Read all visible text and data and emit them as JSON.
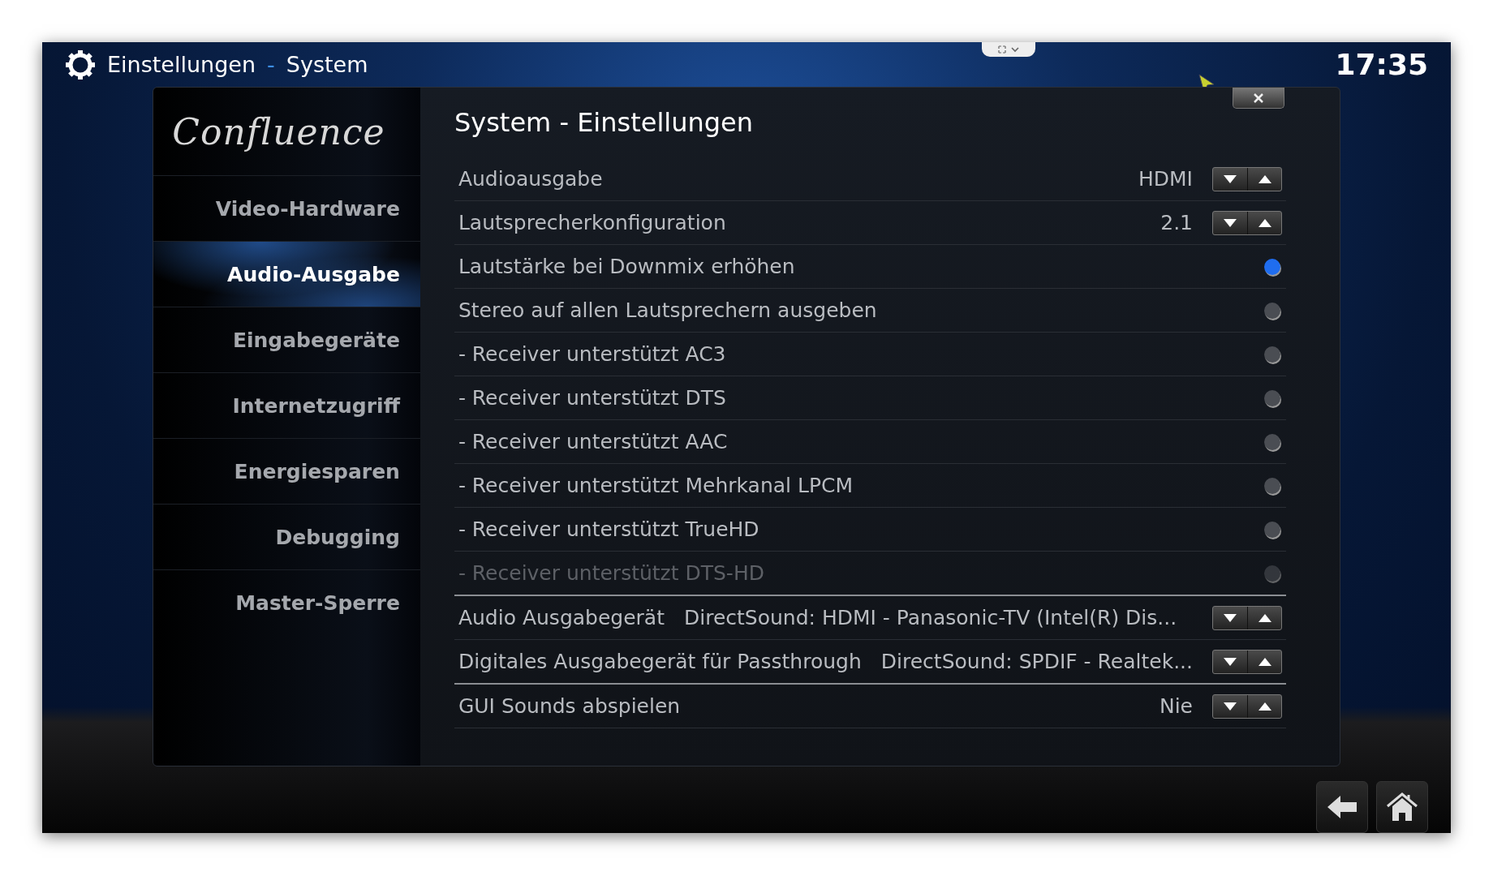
{
  "header": {
    "title": "Einstellungen",
    "separator": "-",
    "subtitle": "System",
    "clock": "17:35"
  },
  "sidebar": {
    "logo": "Confluence",
    "items": [
      {
        "label": "Video-Hardware",
        "selected": false
      },
      {
        "label": "Audio-Ausgabe",
        "selected": true
      },
      {
        "label": "Eingabegeräte",
        "selected": false
      },
      {
        "label": "Internetzugriff",
        "selected": false
      },
      {
        "label": "Energiesparen",
        "selected": false
      },
      {
        "label": "Debugging",
        "selected": false
      },
      {
        "label": "Master-Sperre",
        "selected": false
      }
    ]
  },
  "dialog": {
    "title": "System - Einstellungen",
    "settings": [
      {
        "kind": "spin",
        "label": "Audioausgabe",
        "value": "HDMI",
        "disabled": false
      },
      {
        "kind": "spin",
        "label": "Lautsprecherkonfiguration",
        "value": "2.1",
        "disabled": false
      },
      {
        "kind": "toggle",
        "label": "Lautstärke bei Downmix erhöhen",
        "on": true,
        "disabled": false
      },
      {
        "kind": "toggle",
        "label": "Stereo auf allen Lautsprechern ausgeben",
        "on": false,
        "disabled": false
      },
      {
        "kind": "toggle",
        "label": "- Receiver unterstützt AC3",
        "on": false,
        "disabled": false
      },
      {
        "kind": "toggle",
        "label": "- Receiver unterstützt DTS",
        "on": false,
        "disabled": false
      },
      {
        "kind": "toggle",
        "label": "- Receiver unterstützt AAC",
        "on": false,
        "disabled": false
      },
      {
        "kind": "toggle",
        "label": "- Receiver unterstützt Mehrkanal LPCM",
        "on": false,
        "disabled": false
      },
      {
        "kind": "toggle",
        "label": "- Receiver unterstützt TrueHD",
        "on": false,
        "disabled": false
      },
      {
        "kind": "toggle",
        "label": "- Receiver unterstützt DTS-HD",
        "on": false,
        "disabled": true
      },
      {
        "kind": "spin",
        "label": "Audio Ausgabegerät",
        "value": "DirectSound: HDMI - Panasonic-TV (Intel(R) Dis...",
        "disabled": false,
        "inline": true
      },
      {
        "kind": "spin",
        "label": "Digitales Ausgabegerät für Passthrough",
        "value": "DirectSound: SPDIF - Realtek...",
        "disabled": false,
        "inline": true
      },
      {
        "kind": "spin",
        "label": "GUI Sounds abspielen",
        "value": "Nie",
        "disabled": false
      }
    ]
  }
}
